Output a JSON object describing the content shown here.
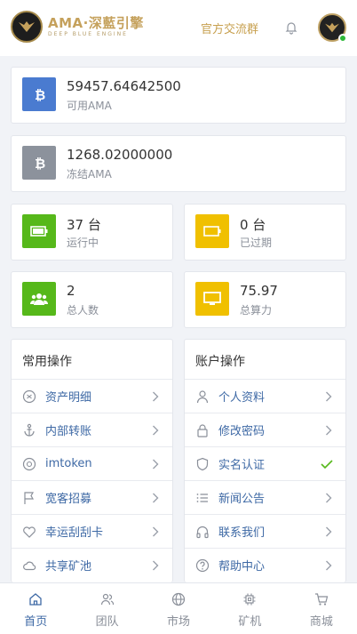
{
  "header": {
    "logo_title": "AMA·深藍引擎",
    "logo_subtitle": "DEEP BLUE ENGINE",
    "group_link": "官方交流群"
  },
  "balances": [
    {
      "value": "59457.64642500",
      "label": "可用AMA",
      "color": "#4a7bd0",
      "icon": "bitcoin-icon"
    },
    {
      "value": "1268.02000000",
      "label": "冻结AMA",
      "color": "#8c929c",
      "icon": "bitcoin-icon"
    }
  ],
  "stats": [
    {
      "value": "37 台",
      "label": "运行中",
      "color": "#56b81a",
      "icon": "battery-full-icon"
    },
    {
      "value": "0 台",
      "label": "已过期",
      "color": "#f0c000",
      "icon": "battery-empty-icon"
    },
    {
      "value": "2",
      "label": "总人数",
      "color": "#56b81a",
      "icon": "users-icon"
    },
    {
      "value": "75.97",
      "label": "总算力",
      "color": "#f0c000",
      "icon": "monitor-icon"
    }
  ],
  "common_ops": {
    "title": "常用操作",
    "items": [
      {
        "label": "资产明细",
        "icon": "asset-icon"
      },
      {
        "label": "内部转账",
        "icon": "anchor-icon"
      },
      {
        "label": "imtoken",
        "icon": "aperture-icon"
      },
      {
        "label": "宽客招募",
        "icon": "flag-icon"
      },
      {
        "label": "幸运刮刮卡",
        "icon": "heart-icon"
      },
      {
        "label": "共享矿池",
        "icon": "cloud-icon"
      }
    ]
  },
  "account_ops": {
    "title": "账户操作",
    "items": [
      {
        "label": "个人资料",
        "icon": "user-icon",
        "status": "arrow"
      },
      {
        "label": "修改密码",
        "icon": "lock-icon",
        "status": "arrow"
      },
      {
        "label": "实名认证",
        "icon": "shield-icon",
        "status": "check"
      },
      {
        "label": "新闻公告",
        "icon": "list-icon",
        "status": "arrow"
      },
      {
        "label": "联系我们",
        "icon": "headphones-icon",
        "status": "arrow"
      },
      {
        "label": "帮助中心",
        "icon": "help-circle-icon",
        "status": "arrow"
      }
    ]
  },
  "tabs": [
    {
      "label": "首页",
      "icon": "home-icon",
      "active": true
    },
    {
      "label": "团队",
      "icon": "team-icon",
      "active": false
    },
    {
      "label": "市场",
      "icon": "globe-icon",
      "active": false
    },
    {
      "label": "矿机",
      "icon": "chip-icon",
      "active": false
    },
    {
      "label": "商城",
      "icon": "cart-icon",
      "active": false
    }
  ]
}
